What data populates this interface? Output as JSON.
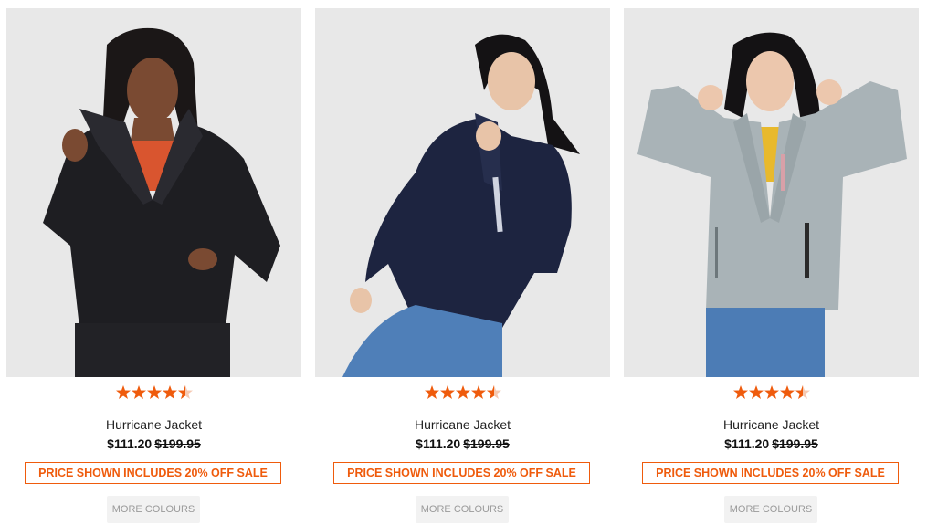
{
  "colors": {
    "accent": "#ef5b0c",
    "photo_background": "#e8e8e8",
    "star": "#ef5b0c",
    "more_colours_bg": "#f2f2f2"
  },
  "products": [
    {
      "name": "Hurricane Jacket",
      "price": "$111.20",
      "was_price": "$199.95",
      "sale_text": "PRICE SHOWN INCLUDES 20% OFF SALE",
      "more_colours": "MORE COLOURS",
      "rating": 4.5,
      "jacket_color": "#1e1e22",
      "image_icon": "product-photo"
    },
    {
      "name": "Hurricane Jacket",
      "price": "$111.20",
      "was_price": "$199.95",
      "sale_text": "PRICE SHOWN INCLUDES 20% OFF SALE",
      "more_colours": "MORE COLOURS",
      "rating": 4.5,
      "jacket_color": "#1d2440",
      "image_icon": "product-photo"
    },
    {
      "name": "Hurricane Jacket",
      "price": "$111.20",
      "was_price": "$199.95",
      "sale_text": "PRICE SHOWN INCLUDES 20% OFF SALE",
      "more_colours": "MORE COLOURS",
      "rating": 4.5,
      "jacket_color": "#a9b3b7",
      "image_icon": "product-photo"
    }
  ]
}
